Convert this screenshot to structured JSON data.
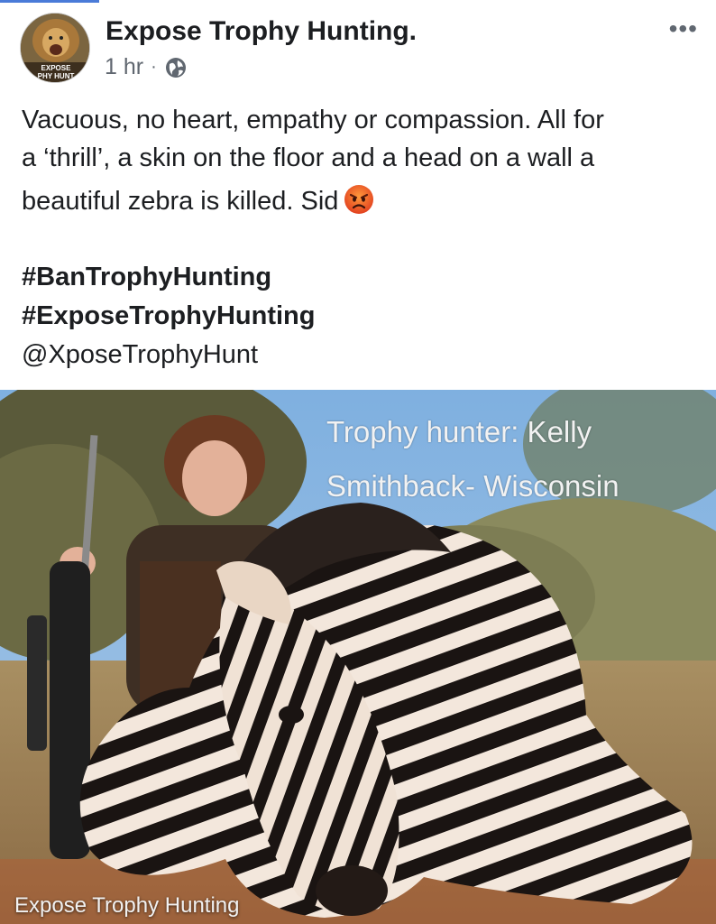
{
  "post": {
    "page_name": "Expose Trophy Hunting.",
    "time": "1 hr",
    "separator": "·",
    "audience_icon": "globe-icon",
    "more_icon": "more-options-icon",
    "more_glyph": "•••",
    "avatar_text": [
      "EXPOSE",
      "PHY HUNT"
    ],
    "body_line1": "Vacuous, no heart, empathy or compassion. All for",
    "body_line2": "a ‘thrill’, a skin on the floor and a head on a wall a",
    "body_line3": "beautiful zebra is killed. Sid",
    "emoji": "angry-face-emoji",
    "hashtags": [
      "#BanTrophyHunting",
      "#ExposeTrophyHunting"
    ],
    "mention": "@XposeTrophyHunt"
  },
  "photo": {
    "caption_line1": "Trophy hunter:  Kelly",
    "caption_line2": "Smithback- Wisconsin",
    "watermark": "Expose Trophy Hunting"
  },
  "colors": {
    "sky": "#7fb0e0",
    "meta_gray": "#606770",
    "text": "#1c1e21"
  }
}
